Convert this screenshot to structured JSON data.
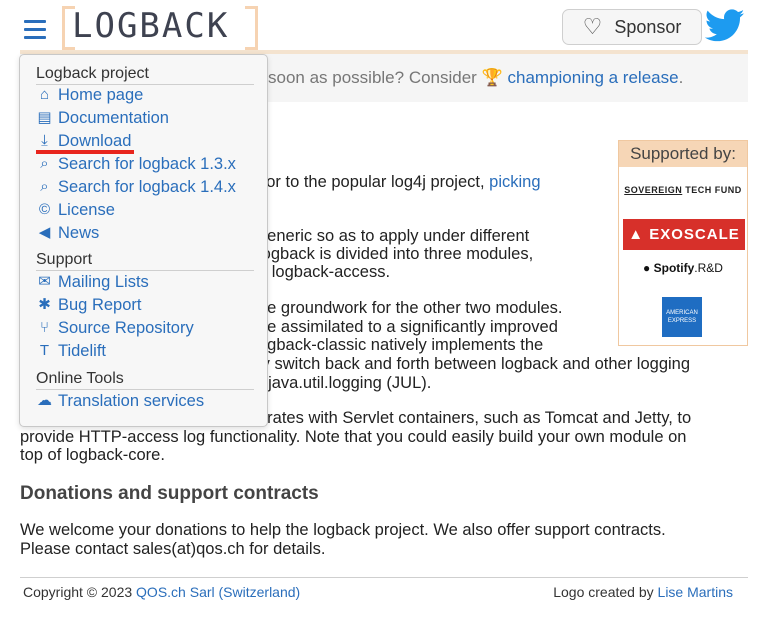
{
  "header": {
    "logo_text": "LOGBACK",
    "sponsor_label": "Sponsor"
  },
  "banner": {
    "text_before": "soon as possible? Consider",
    "link": "championing a release",
    "text_after": "."
  },
  "menu": {
    "sections": [
      {
        "label": "Logback project"
      },
      {
        "label": "Support"
      },
      {
        "label": "Online Tools"
      }
    ],
    "items": [
      {
        "label": "Home page",
        "icon": "home-icon"
      },
      {
        "label": "Documentation",
        "icon": "book-icon"
      },
      {
        "label": "Download",
        "icon": "download-icon"
      },
      {
        "label": "Search for logback 1.3.x",
        "icon": "search-icon"
      },
      {
        "label": "Search for logback 1.4.x",
        "icon": "search-icon"
      },
      {
        "label": "License",
        "icon": "copyright-icon"
      },
      {
        "label": "News",
        "icon": "megaphone-icon"
      },
      {
        "label": "Mailing Lists",
        "icon": "envelope-icon"
      },
      {
        "label": "Bug Report",
        "icon": "bug-icon"
      },
      {
        "label": "Source Repository",
        "icon": "branch-icon"
      },
      {
        "label": "Tidelift",
        "icon": "tidelift-icon"
      },
      {
        "label": "Translation services",
        "icon": "cloud-icon"
      }
    ]
  },
  "content": {
    "p1_a": "sor to the popular log4j project,",
    "p1_link": "picking",
    "p2_1": "generic so as to apply under different",
    "p2_2": "logback is divided into three modules,",
    "p2_3": "d logback-access.",
    "p3_1": "he groundwork for the other two modules.",
    "p3_2": "be assimilated to a significantly improved",
    "p3_3": "ogback-classic natively implements the",
    "p3_4": "ly switch back and forth between logback and other logging",
    "p3_5": "r java.util.logging (JUL).",
    "p4_1": "grates with Servlet containers, such as Tomcat and Jetty, to",
    "p4_2": "provide HTTP-access log functionality. Note that you could easily build your own module on",
    "p4_3": "top of logback-core.",
    "donations_heading": "Donations and support contracts",
    "donations_1": "We welcome your donations to help the logback project. We also offer support contracts.",
    "donations_2": "Please contact sales(at)qos.ch for details."
  },
  "supported": {
    "title": "Supported by:",
    "sovereign_a": "SOVEREIGN",
    "sovereign_b": " TECH FUND",
    "exoscale": "EXOSCALE",
    "spotify_a": "Spotify",
    "spotify_b": ".R&D",
    "amex": "AMERICAN EXPRESS"
  },
  "footer": {
    "copyright": "Copyright © 2023",
    "company_link": "QOS.ch Sarl (Switzerland)",
    "logo_credit": "Logo created by",
    "designer_link": "Lise Martins"
  },
  "colors": {
    "link": "#2a6ebb",
    "accent": "#f6d3b2",
    "red_underline": "#e8251d"
  }
}
